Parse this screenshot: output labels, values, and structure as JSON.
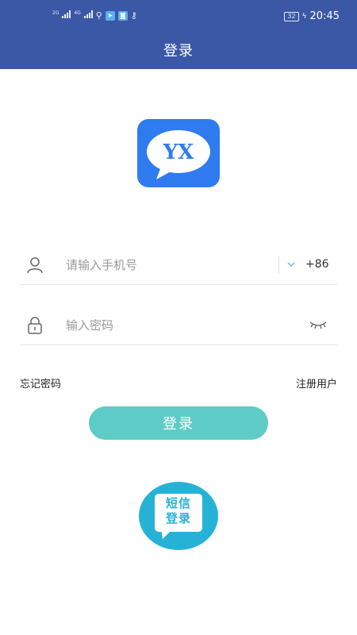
{
  "status_bar": {
    "net1": "2G",
    "net2": "4G",
    "battery": "32",
    "time": "20:45"
  },
  "header": {
    "title": "登录"
  },
  "logo": {
    "text": "YX"
  },
  "form": {
    "phone_placeholder": "请输入手机号",
    "country_code": "+86",
    "password_placeholder": "输入密码"
  },
  "links": {
    "forgot_password": "忘记密码",
    "register": "注册用户"
  },
  "login_button": "登录",
  "sms_login": {
    "line1": "短信",
    "line2": "登录"
  },
  "colors": {
    "header": "#3a58a6",
    "login_button": "#5fcbc6",
    "sms_button": "#26b2d6",
    "logo": "#2f7bf0"
  }
}
